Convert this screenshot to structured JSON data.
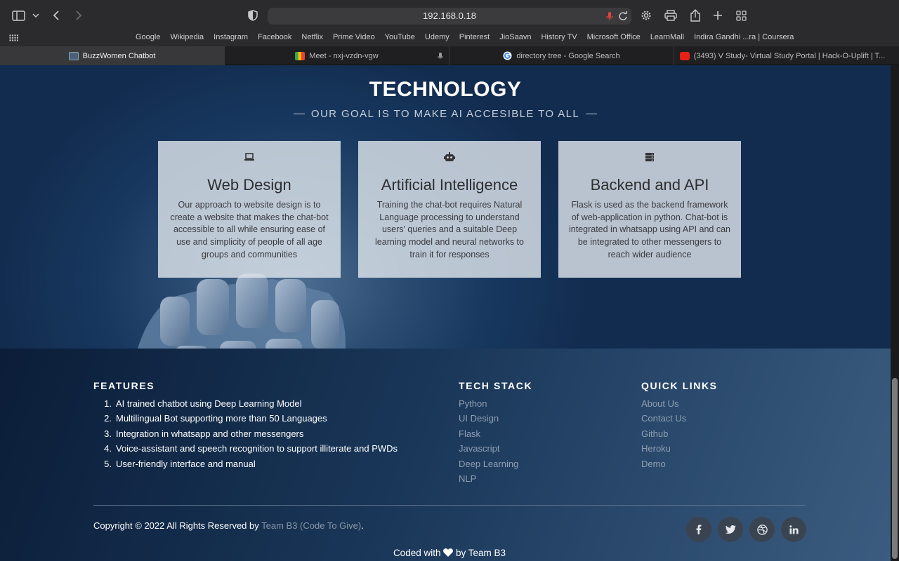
{
  "browser": {
    "url": "192.168.0.18",
    "bookmarks": [
      "Google",
      "Wikipedia",
      "Instagram",
      "Facebook",
      "Netflix",
      "Prime Video",
      "YouTube",
      "Udemy",
      "Pinterest",
      "JioSaavn",
      "History TV",
      "Microsoft Office",
      "LearnMall",
      "Indira Gandhi ...ra | Coursera"
    ],
    "tabs": [
      {
        "label": "BuzzWomen Chatbot",
        "active": true
      },
      {
        "label": "Meet - nxj-vzdn-vgw"
      },
      {
        "label": "directory tree - Google Search"
      },
      {
        "label": "(3493) V Study- Virtual Study Portal | Hack-O-Uplift | T..."
      }
    ]
  },
  "technology": {
    "title": "TECHNOLOGY",
    "subtitle": "OUR GOAL IS TO MAKE AI ACCESIBLE TO ALL",
    "cards": [
      {
        "icon": "laptop-icon",
        "title": "Web Design",
        "description": "Our approach to website design is to create a website that makes the chat-bot accessible to all while ensuring ease of use and simplicity of people of all age groups and communities"
      },
      {
        "icon": "robot-icon",
        "title": "Artificial Intelligence",
        "description": "Training the chat-bot requires Natural Language processing to understand users' queries and a suitable Deep learning model and neural networks to train it for responses"
      },
      {
        "icon": "server-icon",
        "title": "Backend and API",
        "description": "Flask is used as the backend framework of web-application in python. Chat-bot is integrated in whatsapp using API and can be integrated to other messengers to reach wider audience"
      }
    ]
  },
  "footer": {
    "features": {
      "heading": "FEATURES",
      "items": [
        "AI trained chatbot using Deep Learning Model",
        "Multilingual Bot supporting more than 50 Languages",
        "Integration in whatsapp and other messengers",
        "Voice-assistant and speech recognition to support illiterate and PWDs",
        "User-friendly interface and manual"
      ]
    },
    "tech_stack": {
      "heading": "TECH STACK",
      "items": [
        "Python",
        "UI Design",
        "Flask",
        "Javascript",
        "Deep Learning",
        "NLP"
      ]
    },
    "quick_links": {
      "heading": "QUICK LINKS",
      "items": [
        "About Us",
        "Contact Us",
        "Github",
        "Heroku",
        "Demo"
      ]
    },
    "copyright_prefix": "Copyright © 2022 All Rights Reserved by ",
    "copyright_team": "Team B3 (Code To Give)",
    "copyright_suffix": ".",
    "social": [
      "facebook-icon",
      "twitter-icon",
      "dribbble-icon",
      "linkedin-icon"
    ],
    "coded_prefix": "Coded with",
    "coded_suffix": "by Team B3"
  },
  "colors": {
    "tech_bg": "#183860",
    "card_bg": "#dee4ec",
    "footer_link": "#8f9fb2",
    "social_bg": "#3a4450"
  }
}
